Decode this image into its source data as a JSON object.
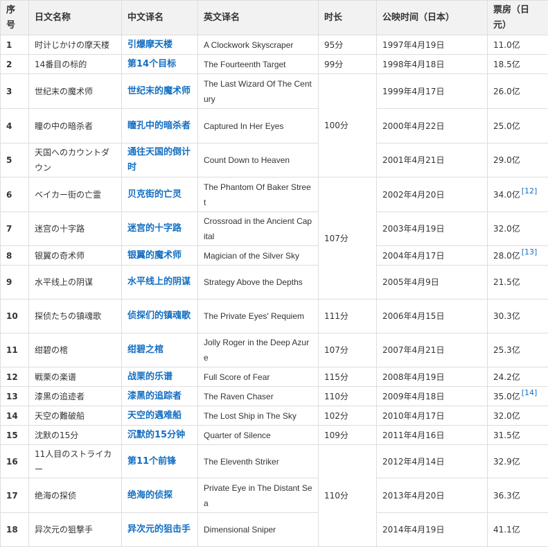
{
  "headers": [
    "序号",
    "日文名称",
    "中文译名",
    "英文译名",
    "时长",
    "公映时间（日本）",
    "票房（日元）"
  ],
  "films": [
    {
      "idx": "1",
      "jp": "时计じかけの摩天楼",
      "cn": "引爆摩天楼",
      "en": "A Clockwork Skyscraper",
      "dt": "1997年4月19日",
      "bo": "11.0亿",
      "ref": ""
    },
    {
      "idx": "2",
      "jp": "14番目の标的",
      "cn": "第14个目标",
      "en": "The Fourteenth Target",
      "dt": "1998年4月18日",
      "bo": "18.5亿",
      "ref": ""
    },
    {
      "idx": "3",
      "jp": "世纪末の魔术师",
      "cn": "世纪末的魔术师",
      "en": "The Last Wizard Of The Century",
      "dt": "1999年4月17日",
      "bo": "26.0亿",
      "ref": ""
    },
    {
      "idx": "4",
      "jp": "瞳の中の暗杀者",
      "cn": "瞳孔中的暗杀者",
      "en": "Captured In Her Eyes",
      "dt": "2000年4月22日",
      "bo": "25.0亿",
      "ref": ""
    },
    {
      "idx": "5",
      "jp": "天国へのカウントダウン",
      "cn": "通往天国的倒计时",
      "en": "Count Down to Heaven",
      "dt": "2001年4月21日",
      "bo": "29.0亿",
      "ref": ""
    },
    {
      "idx": "6",
      "jp": "ベイカー街の亡霊",
      "cn": "贝克街的亡灵",
      "en": "The Phantom Of Baker Street",
      "dt": "2002年4月20日",
      "bo": "34.0亿",
      "ref": "[12]"
    },
    {
      "idx": "7",
      "jp": "迷宫の十字路",
      "cn": "迷宫的十字路",
      "en": "Crossroad in the Ancient Capital",
      "dt": "2003年4月19日",
      "bo": "32.0亿",
      "ref": ""
    },
    {
      "idx": "8",
      "jp": "银翼の奇术师",
      "cn": "银翼的魔术师",
      "en": "Magician of the Silver Sky",
      "dt": "2004年4月17日",
      "bo": "28.0亿",
      "ref": "[13]"
    },
    {
      "idx": "9",
      "jp": "水平线上の阴谋",
      "cn": "水平线上的阴谋",
      "en": "Strategy Above the Depths",
      "dt": "2005年4月9日",
      "bo": "21.5亿",
      "ref": ""
    },
    {
      "idx": "10",
      "jp": "探侦たちの镇魂歌",
      "cn": "侦探们的镇魂歌",
      "en": "The Private Eyes' Requiem",
      "dt": "2006年4月15日",
      "bo": "30.3亿",
      "ref": ""
    },
    {
      "idx": "11",
      "jp": "绀碧の棺",
      "cn": "绀碧之棺",
      "en": "Jolly Roger in the Deep Azure",
      "dt": "2007年4月21日",
      "bo": "25.3亿",
      "ref": ""
    },
    {
      "idx": "12",
      "jp": "戦栗の楽谱",
      "cn": "战栗的乐谱",
      "en": "Full Score of Fear",
      "dt": "2008年4月19日",
      "bo": "24.2亿",
      "ref": ""
    },
    {
      "idx": "13",
      "jp": "漆黒の追迹者",
      "cn": "漆黑的追踪者",
      "en": "The Raven Chaser",
      "dt": "2009年4月18日",
      "bo": "35.0亿",
      "ref": "[14]"
    },
    {
      "idx": "14",
      "jp": "天空の難破船",
      "cn": "天空的遇难船",
      "en": "The Lost Ship in The Sky",
      "dt": "2010年4月17日",
      "bo": "32.0亿",
      "ref": ""
    },
    {
      "idx": "15",
      "jp": "沈默の15分",
      "cn": "沉默的15分钟",
      "en": "Quarter of Silence",
      "dt": "2011年4月16日",
      "bo": "31.5亿",
      "ref": ""
    },
    {
      "idx": "16",
      "jp": "11人目のストライカー",
      "cn": "第11个前锋",
      "en": "The Eleventh Striker",
      "dt": "2012年4月14日",
      "bo": "32.9亿",
      "ref": ""
    },
    {
      "idx": "17",
      "jp": "绝海の探侦",
      "cn": "绝海的侦探",
      "en": "Private Eye in The Distant Sea",
      "dt": "2013年4月20日",
      "bo": "36.3亿",
      "ref": ""
    },
    {
      "idx": "18",
      "jp": "异次元の狙撃手",
      "cn": "异次元的狙击手",
      "en": "Dimensional Sniper",
      "dt": "2014年4月19日",
      "bo": "41.1亿",
      "ref": ""
    }
  ],
  "runtimes": [
    {
      "text": "95分"
    },
    {
      "text": "99分"
    },
    {
      "text": "100分"
    },
    {
      "text": "107分"
    },
    {
      "text": "111分"
    },
    {
      "text": "107分"
    },
    {
      "text": "115分"
    },
    {
      "text": "110分"
    },
    {
      "text": "102分"
    },
    {
      "text": "109分"
    },
    {
      "text": "110分"
    }
  ]
}
